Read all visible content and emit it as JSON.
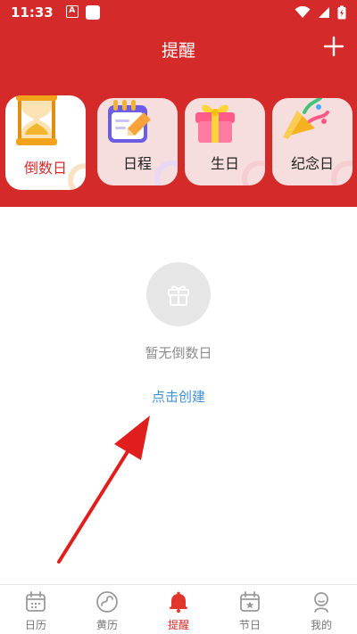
{
  "status_bar": {
    "time": "11:33",
    "left_icon_text": "A"
  },
  "header": {
    "title": "提醒",
    "add_icon": "plus-icon"
  },
  "categories": [
    {
      "label": "倒数日",
      "icon": "hourglass-icon",
      "active": true
    },
    {
      "label": "日程",
      "icon": "calendar-pen-icon",
      "active": false
    },
    {
      "label": "生日",
      "icon": "gift-icon",
      "active": false
    },
    {
      "label": "纪念日",
      "icon": "party-horn-icon",
      "active": false
    }
  ],
  "empty_state": {
    "icon": "gift-outline-icon",
    "message": "暂无倒数日",
    "create_link": "点击创建"
  },
  "bottom_nav": [
    {
      "label": "日历",
      "icon": "calendar-icon",
      "active": false
    },
    {
      "label": "黄历",
      "icon": "yin-yang-icon",
      "active": false
    },
    {
      "label": "提醒",
      "icon": "bell-icon",
      "active": true
    },
    {
      "label": "节日",
      "icon": "festival-calendar-icon",
      "active": false
    },
    {
      "label": "我的",
      "icon": "profile-icon",
      "active": false
    }
  ],
  "colors": {
    "brand_red": "#d42a2a",
    "link_blue": "#3f91d6"
  }
}
